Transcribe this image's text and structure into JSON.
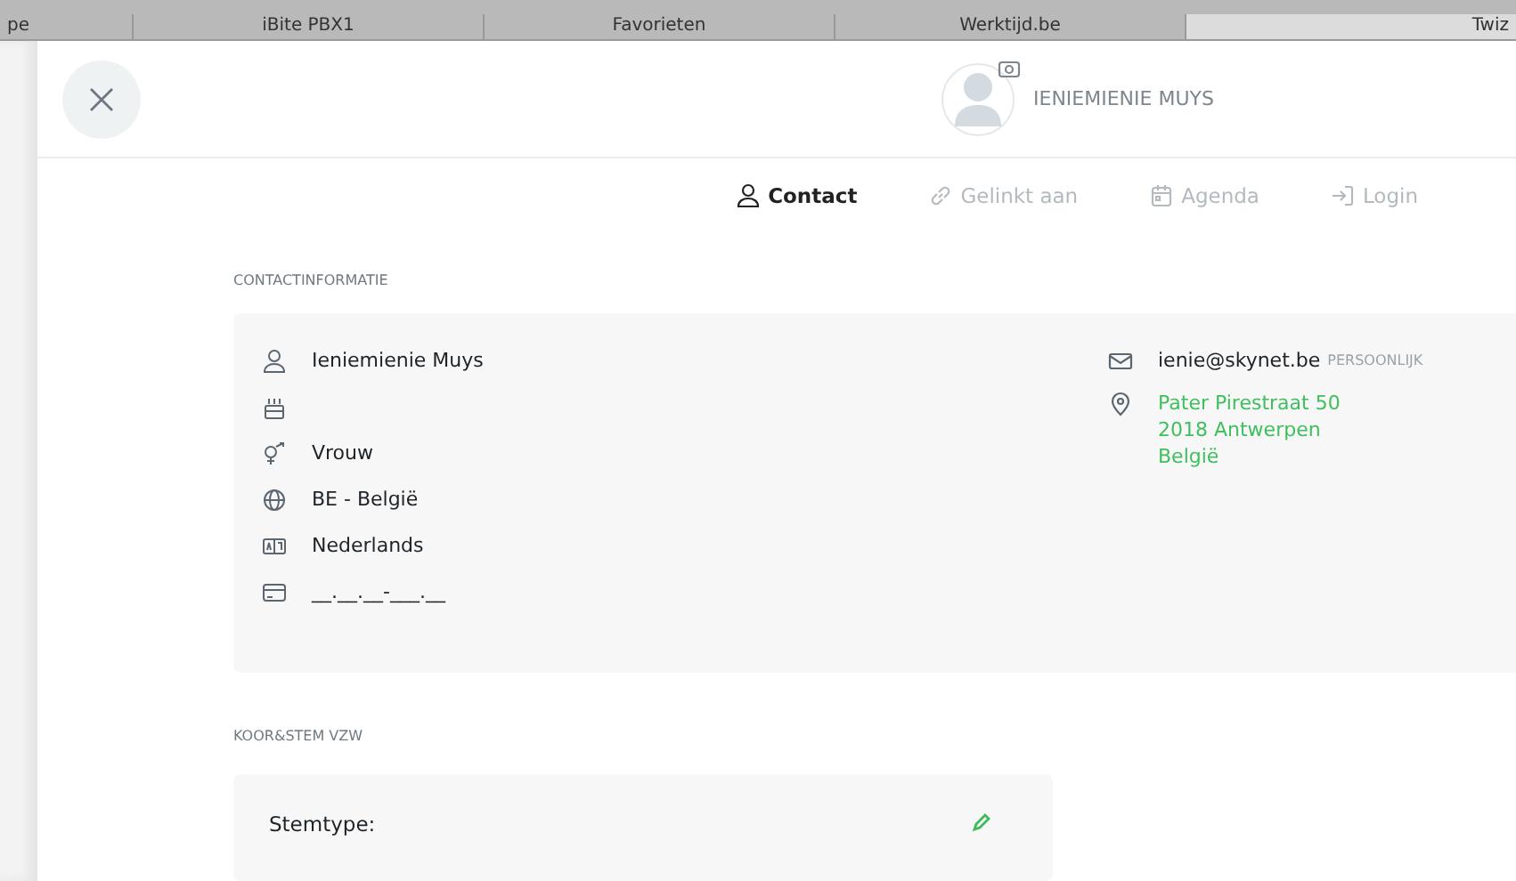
{
  "bookmarks_bar": [
    {
      "label": "pe",
      "selected": false
    },
    {
      "label": "iBite PBX1",
      "selected": false
    },
    {
      "label": "Favorieten",
      "selected": false
    },
    {
      "label": "Werktijd.be",
      "selected": false
    },
    {
      "label": "Twiz",
      "selected": true
    }
  ],
  "profile": {
    "name": "IENIEMIENIE MUYS"
  },
  "tabs": [
    {
      "label": "Contact",
      "kind": "person",
      "selected": true
    },
    {
      "label": "Gelinkt aan",
      "kind": "link",
      "selected": false
    },
    {
      "label": "Agenda",
      "kind": "calendar",
      "selected": false
    },
    {
      "label": "Login",
      "kind": "login",
      "selected": false
    }
  ],
  "contact_section": {
    "heading": "CONTACTINFORMATIE",
    "left_rows": [
      {
        "kind": "person",
        "text": "Ieniemienie Muys"
      },
      {
        "kind": "cake"
      },
      {
        "kind": "gender",
        "text": "Vrouw"
      },
      {
        "kind": "globe",
        "text": "BE - België"
      },
      {
        "kind": "language",
        "text": "Nederlands"
      },
      {
        "kind": "card",
        "text": "__.__.__-___.__"
      }
    ],
    "email": {
      "text": "ienie@skynet.be",
      "tag": "PERSOONLIJK"
    },
    "address": [
      "Pater Pirestraat 50",
      "2018 Antwerpen",
      "België"
    ]
  },
  "org_section": {
    "heading": "KOOR&STEM VZW",
    "field_label": "Stemtype:"
  }
}
